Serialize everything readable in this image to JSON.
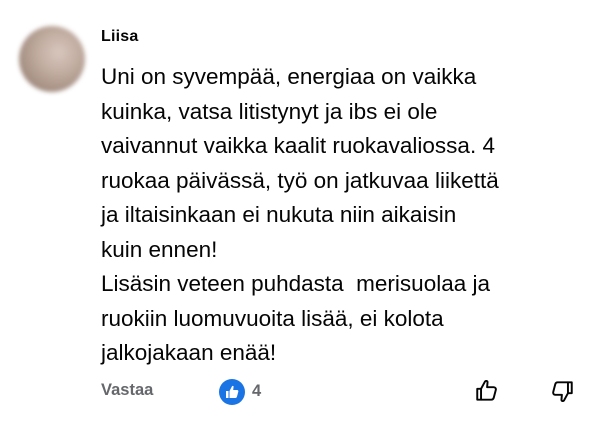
{
  "comment": {
    "author": "Liisa",
    "text": "Uni on syvempää, energiaa on vaikka\nkuinka, vatsa litistynyt ja ibs ei ole\nvaivannut vaikka kaalit ruokavaliossa. 4\nruokaa päivässä, työ on jatkuvaa liikettä\nja iltaisinkaan ei nukuta niin aikaisin\nkuin ennen!\nLisäsin veteen puhdasta  merisuolaa ja\nruokiin luomuvuoita lisää, ei kolota\njalkojakaan enää!",
    "reply_label": "Vastaa",
    "like_count": "4"
  },
  "icons": {
    "like_badge": "thumbs-up-icon",
    "like_button": "thumbs-up-outline-icon",
    "dislike_button": "thumbs-down-outline-icon"
  },
  "colors": {
    "like_badge": "#1b74e4",
    "secondary_text": "#65676b",
    "primary_text": "#050505"
  }
}
